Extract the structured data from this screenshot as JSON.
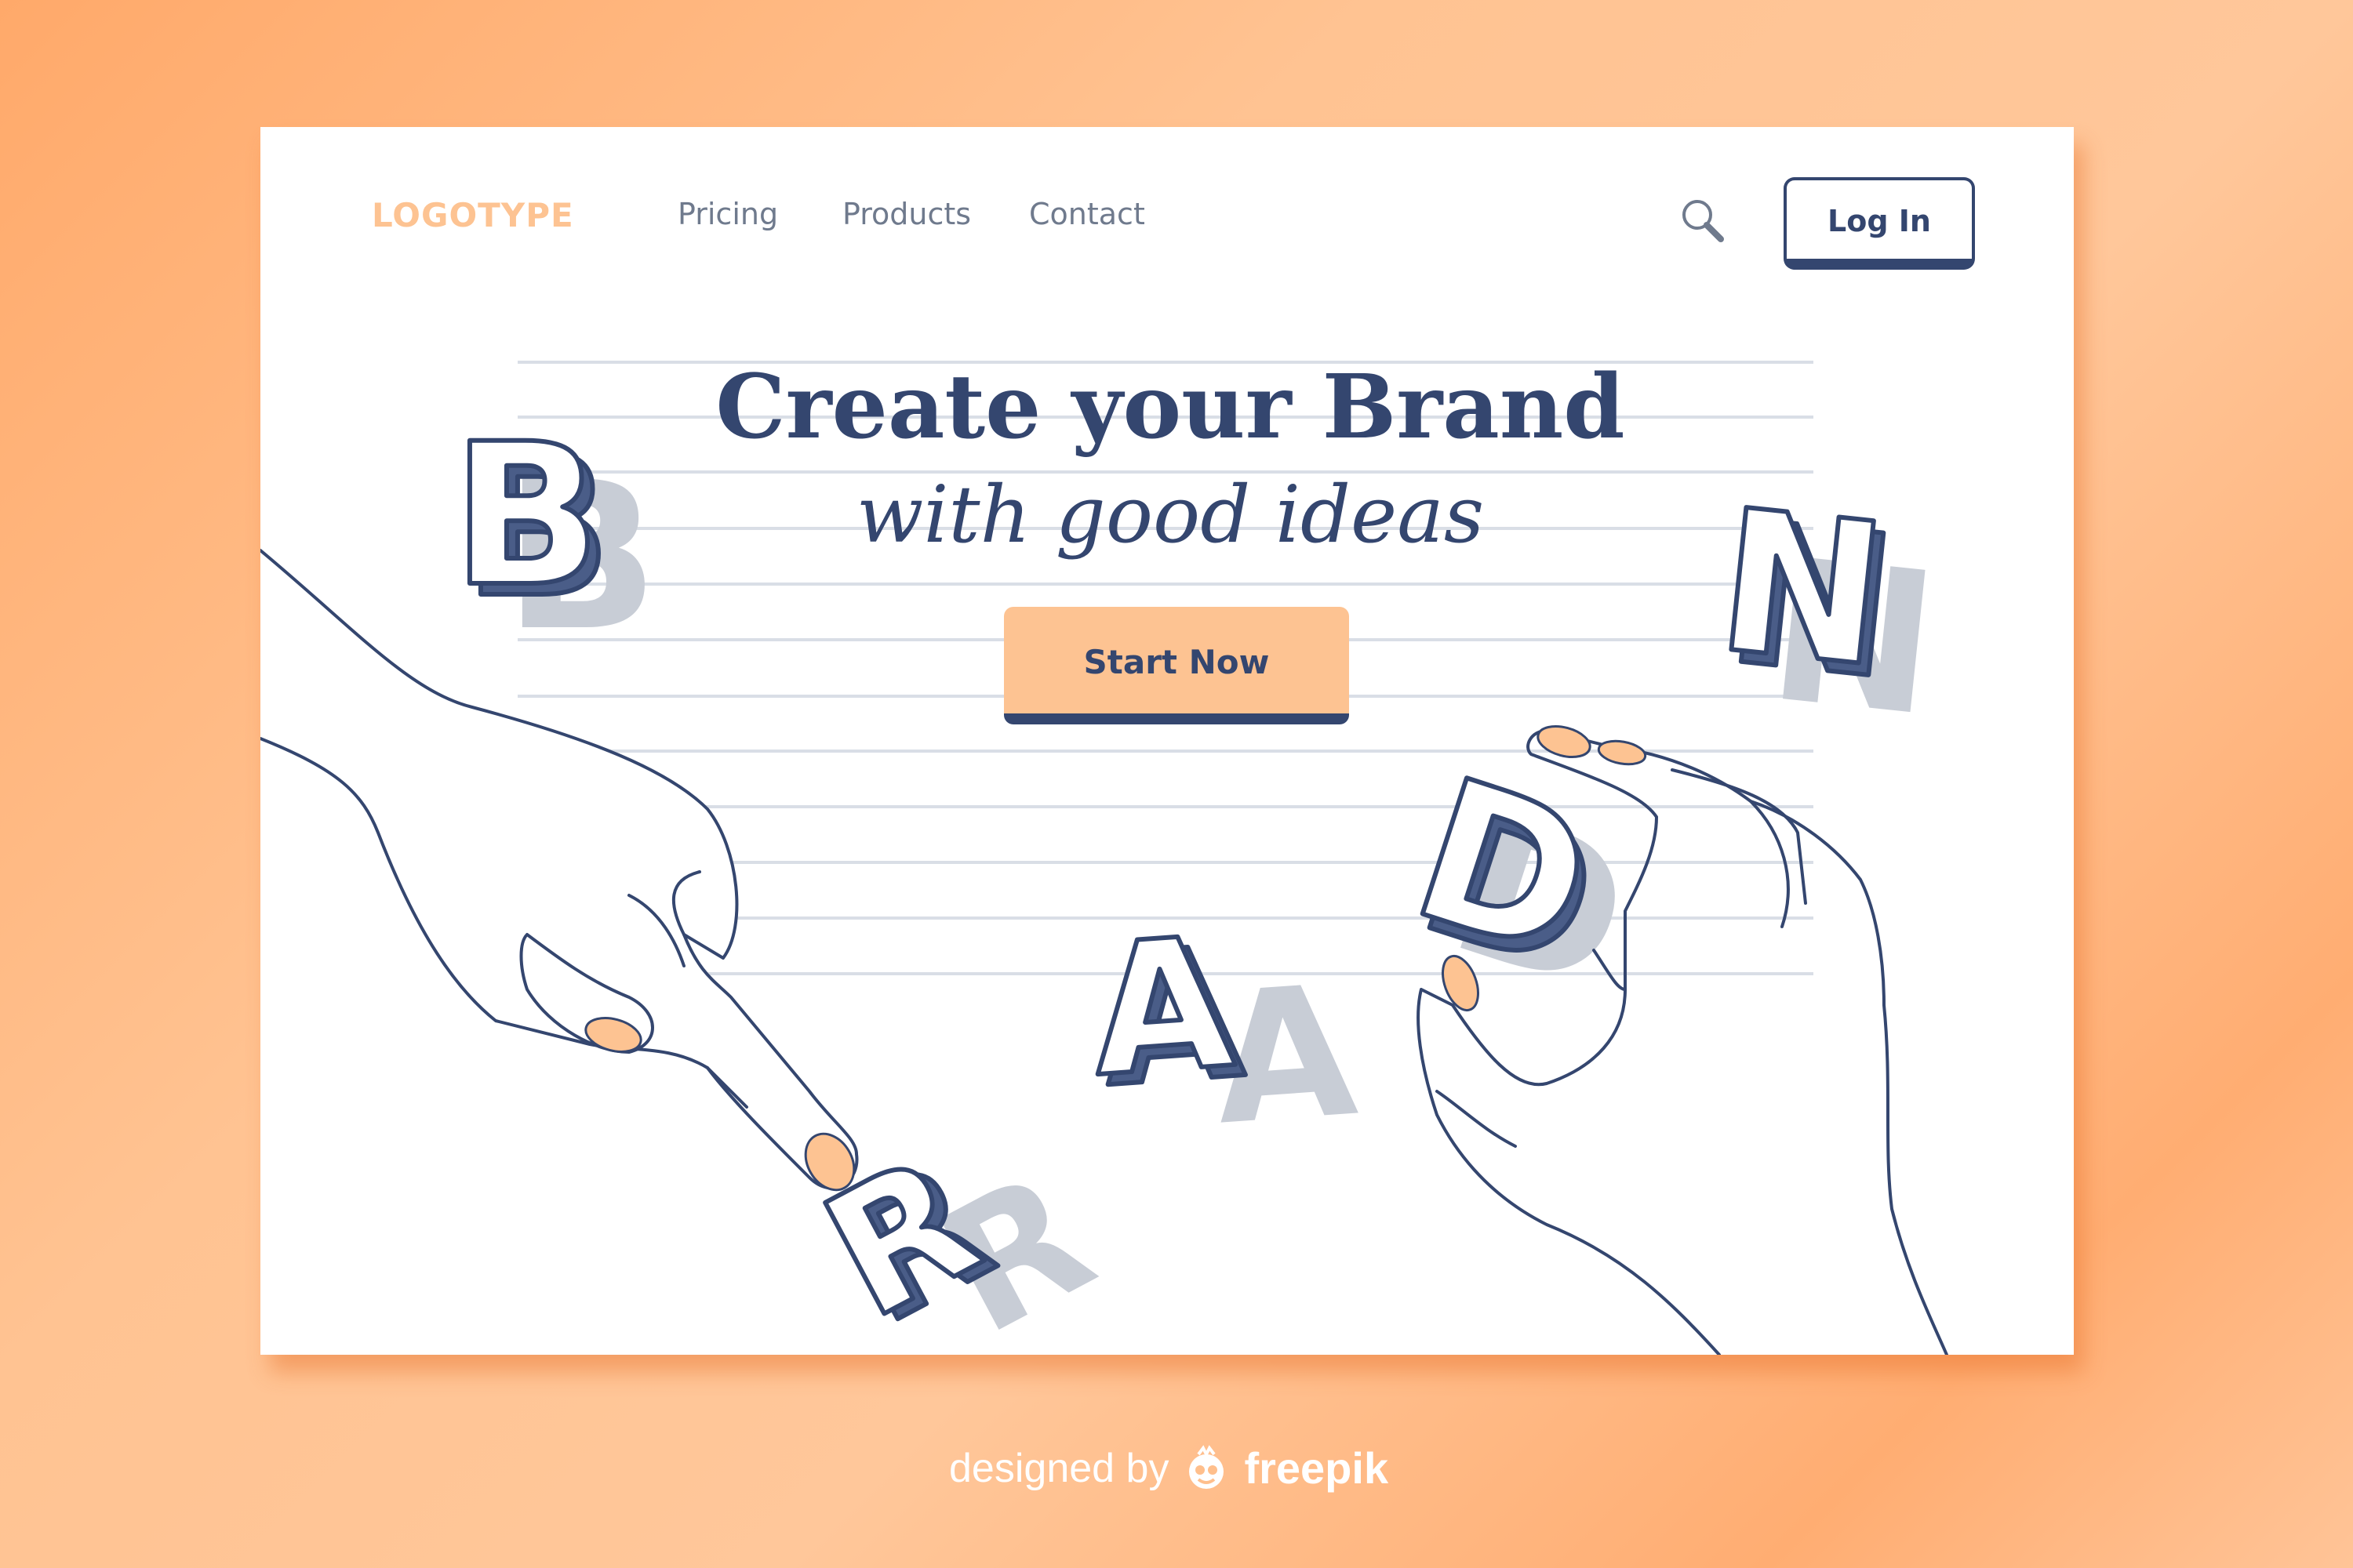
{
  "header": {
    "logo": "LOGOTYPE",
    "nav": [
      {
        "label": "Pricing"
      },
      {
        "label": "Products"
      },
      {
        "label": "Contact"
      }
    ],
    "search_icon": "search-icon",
    "login_label": "Log In"
  },
  "hero": {
    "title": "Create your Brand",
    "subtitle": "with good ideas",
    "cta_label": "Start Now"
  },
  "illustration_letters": [
    "B",
    "R",
    "A",
    "N",
    "D"
  ],
  "credit": {
    "prefix": "designed by",
    "brand": "freepik",
    "brand_icon": "freepik-logo-icon"
  },
  "colors": {
    "background": "#ffb57e",
    "card": "#ffffff",
    "navy": "#34466f",
    "peach": "#fdc392",
    "shadow_letter": "#c8cdd6",
    "nav_text": "#6f7a8d",
    "stripe": "#d9dee6"
  }
}
